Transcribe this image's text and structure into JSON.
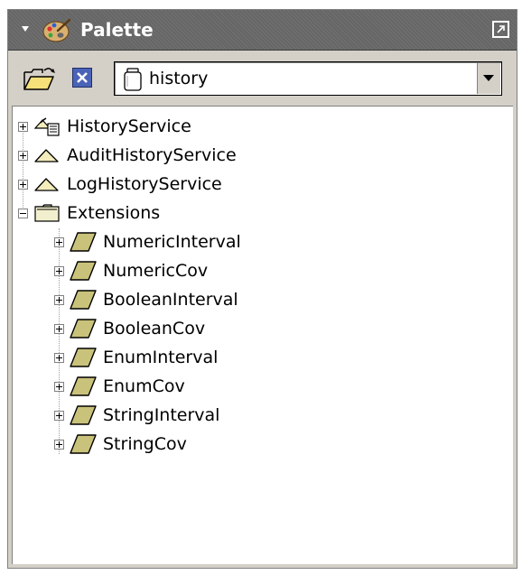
{
  "palette": {
    "title": "Palette",
    "selected_palette": "history"
  },
  "tree": {
    "services": [
      {
        "label": "HistoryService",
        "icon": "history-service-icon"
      },
      {
        "label": "AuditHistoryService",
        "icon": "triangle-icon"
      },
      {
        "label": "LogHistoryService",
        "icon": "triangle-icon"
      }
    ],
    "folder": {
      "label": "Extensions",
      "icon": "folder-icon",
      "expanded": true
    },
    "extensions": [
      {
        "label": "NumericInterval",
        "icon": "extension-icon"
      },
      {
        "label": "NumericCov",
        "icon": "extension-icon"
      },
      {
        "label": "BooleanInterval",
        "icon": "extension-icon"
      },
      {
        "label": "BooleanCov",
        "icon": "extension-icon"
      },
      {
        "label": "EnumInterval",
        "icon": "extension-icon"
      },
      {
        "label": "EnumCov",
        "icon": "extension-icon"
      },
      {
        "label": "StringInterval",
        "icon": "extension-icon"
      },
      {
        "label": "StringCov",
        "icon": "extension-icon"
      }
    ]
  },
  "colors": {
    "title_bar": "#666666",
    "extension_icon_fill": "#c9c27a",
    "folder_fill": "#f2efce",
    "close_button": "#4a63b8"
  }
}
